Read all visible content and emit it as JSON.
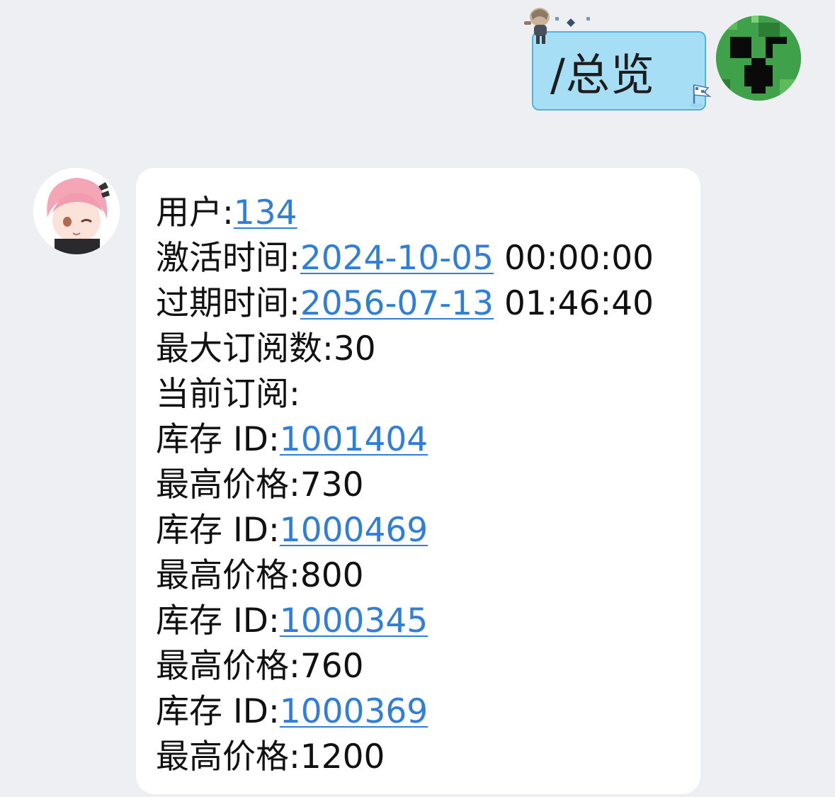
{
  "sent_message": {
    "text": "/总览"
  },
  "received_message": {
    "user_label": "用户:",
    "user_id": "134",
    "activation_label": "激活时间:",
    "activation_date": "2024-10-05",
    "activation_time": " 00:00:00",
    "expiry_label": "过期时间:",
    "expiry_date": "2056-07-13",
    "expiry_time": " 01:46:40",
    "max_subs_label": "最大订阅数:",
    "max_subs_value": "30",
    "current_subs_label": "当前订阅:",
    "subscriptions": [
      {
        "id_label": "库存 ID:",
        "id": "1001404",
        "price_label": "最高价格:",
        "price": "730"
      },
      {
        "id_label": "库存 ID:",
        "id": "1000469",
        "price_label": "最高价格:",
        "price": "800"
      },
      {
        "id_label": "库存 ID:",
        "id": "1000345",
        "price_label": "最高价格:",
        "price": "760"
      },
      {
        "id_label": "库存 ID:",
        "id": "1000369",
        "price_label": "最高价格:",
        "price": "1200"
      }
    ]
  },
  "colors": {
    "background": "#eeeff3",
    "sent_bubble": "#a6dff5",
    "sent_bubble_border": "#4fb3df",
    "link": "#2f7fd8",
    "received_bubble": "#ffffff"
  },
  "icons": {
    "sender_avatar": "creeper-avatar-icon",
    "bot_avatar": "anime-girl-avatar-icon",
    "bubble_decoration": "chibi-character-icon",
    "bubble_flag": "flag-icon"
  }
}
